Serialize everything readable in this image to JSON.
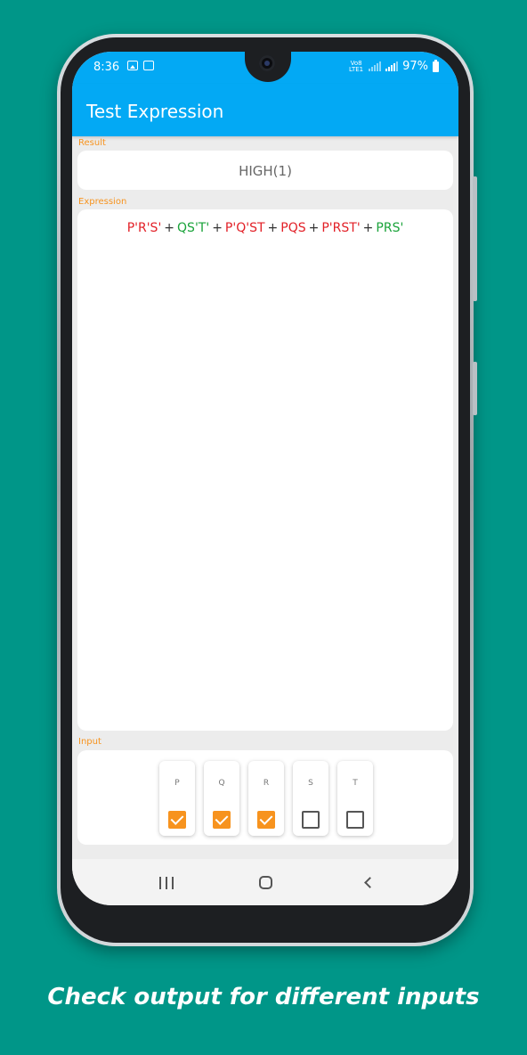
{
  "status_bar": {
    "time": "8:36",
    "icons": [
      "image-icon",
      "app-v-icon"
    ],
    "network": "Vo8 LTE1",
    "battery": "97%"
  },
  "app_bar": {
    "title": "Test Expression"
  },
  "result": {
    "label": "Result",
    "value": "HIGH(1)"
  },
  "expression": {
    "label": "Expression",
    "terms": [
      {
        "text": "P'R'S'",
        "state": "low"
      },
      {
        "text": "QS'T'",
        "state": "high"
      },
      {
        "text": "P'Q'ST",
        "state": "low"
      },
      {
        "text": "PQS",
        "state": "low"
      },
      {
        "text": "P'RST'",
        "state": "low"
      },
      {
        "text": "PRS'",
        "state": "high"
      }
    ],
    "operator": "+",
    "colors": {
      "low": "#e21f26",
      "high": "#1aa33a"
    }
  },
  "input": {
    "label": "Input",
    "variables": [
      {
        "name": "P",
        "checked": true
      },
      {
        "name": "Q",
        "checked": true
      },
      {
        "name": "R",
        "checked": true
      },
      {
        "name": "S",
        "checked": false
      },
      {
        "name": "T",
        "checked": false
      }
    ]
  },
  "colors": {
    "background": "#009688",
    "app_bar": "#03a9f4",
    "accent": "#f7931e"
  },
  "caption": "Check output for different inputs"
}
